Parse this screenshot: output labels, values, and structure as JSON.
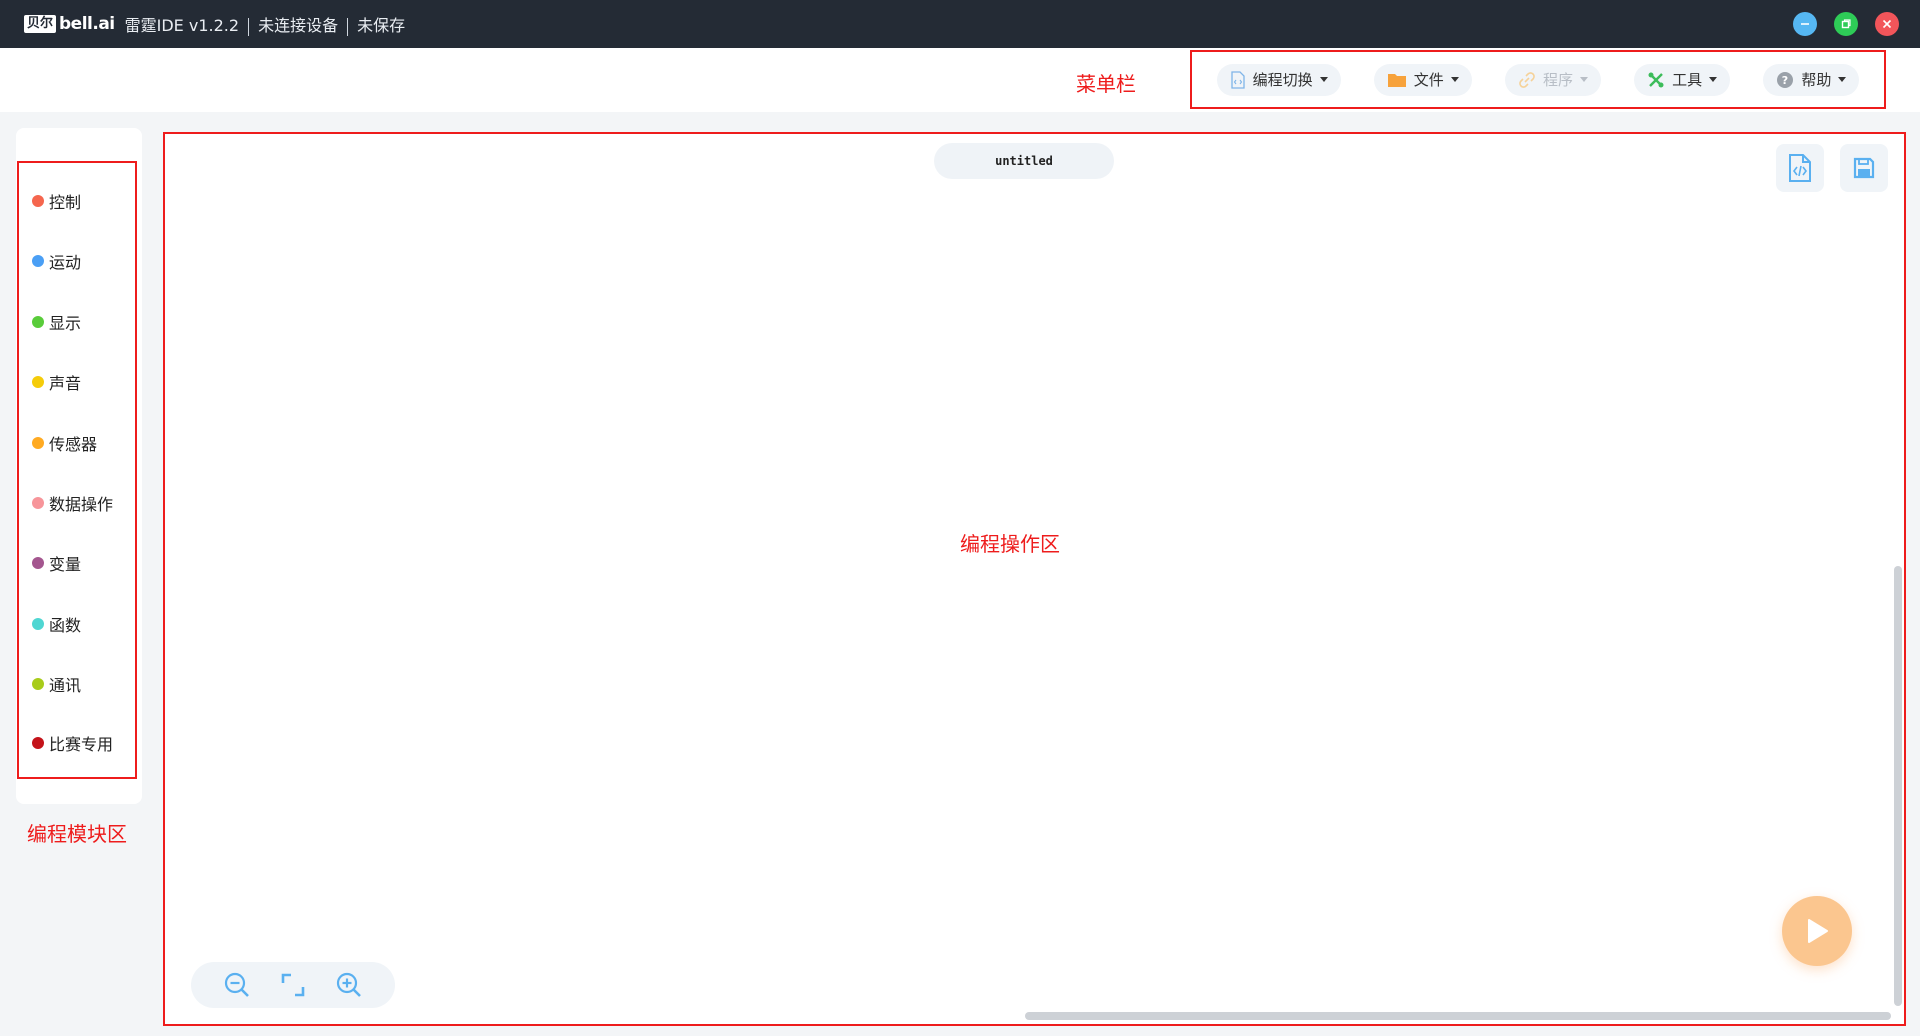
{
  "titlebar": {
    "brand_badge": "贝尔",
    "brand_text": "bell.ai",
    "app_name": "雷霆IDE v1.2.2",
    "connection_status": "未连接设备",
    "save_status": "未保存",
    "minimize_icon": "minimize-icon",
    "maximize_icon": "restore-icon",
    "close_icon": "close-icon",
    "colors": {
      "bar": "#242b35",
      "minimize": "#56b7f2",
      "maximize": "#2ecc57",
      "close": "#f2555a"
    }
  },
  "annotations": {
    "menu_label": "菜单栏",
    "blocks_label": "编程模块区",
    "workspace_label": "编程操作区",
    "color": "#ee1c1c"
  },
  "menu": {
    "items": [
      {
        "label": "编程切换",
        "icon": "code-file-icon",
        "enabled": true
      },
      {
        "label": "文件",
        "icon": "folder-icon",
        "enabled": true
      },
      {
        "label": "程序",
        "icon": "link-icon",
        "enabled": false
      },
      {
        "label": "工具",
        "icon": "tools-icon",
        "enabled": true
      },
      {
        "label": "帮助",
        "icon": "help-icon",
        "enabled": true
      }
    ]
  },
  "categories": [
    {
      "label": "控制",
      "color": "#f5664e"
    },
    {
      "label": "运动",
      "color": "#4a9ff5"
    },
    {
      "label": "显示",
      "color": "#59cc3a"
    },
    {
      "label": "声音",
      "color": "#f5cc0a"
    },
    {
      "label": "传感器",
      "color": "#ffaa22"
    },
    {
      "label": "数据操作",
      "color": "#f7959a"
    },
    {
      "label": "变量",
      "color": "#a4568f"
    },
    {
      "label": "函数",
      "color": "#4fd6d2"
    },
    {
      "label": "通讯",
      "color": "#a8cc1a"
    },
    {
      "label": "比赛专用",
      "color": "#c4131a"
    }
  ],
  "workspace": {
    "file_name": "untitled",
    "code_view_icon": "code-view-icon",
    "save_icon": "save-icon",
    "zoom_out_icon": "zoom-out-icon",
    "reset_zoom_icon": "fit-screen-icon",
    "zoom_in_icon": "zoom-in-icon",
    "run_icon": "play-icon",
    "accent": "#5ab0f0",
    "run_color": "#fbc68f"
  }
}
